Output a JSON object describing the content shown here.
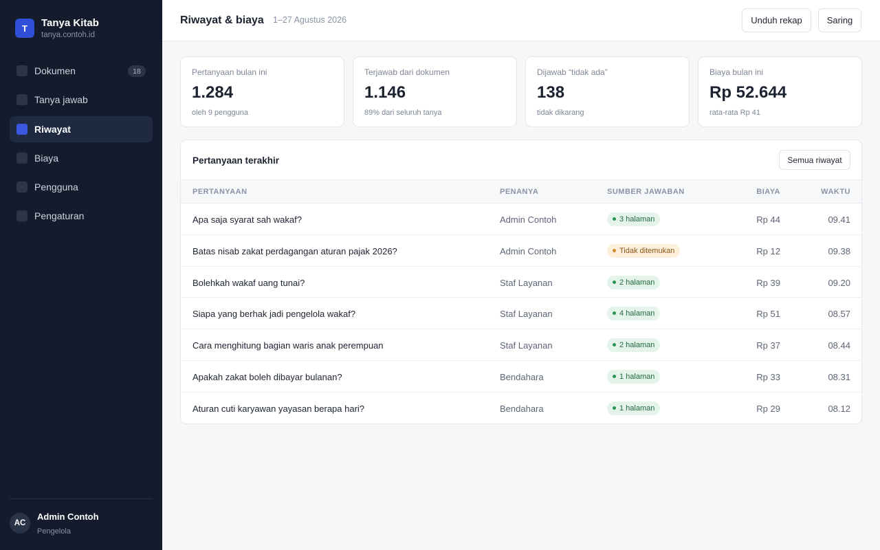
{
  "brand": {
    "logo_letter": "T",
    "name": "Tanya Kitab",
    "domain": "tanya.contoh.id"
  },
  "sidebar": {
    "items": [
      {
        "label": "Dokumen",
        "badge": "18",
        "active": false
      },
      {
        "label": "Tanya jawab",
        "active": false
      },
      {
        "label": "Riwayat",
        "active": true
      },
      {
        "label": "Biaya",
        "active": false
      },
      {
        "label": "Pengguna",
        "active": false
      },
      {
        "label": "Pengaturan",
        "active": false
      }
    ]
  },
  "user": {
    "initials": "AC",
    "name": "Admin Contoh",
    "role": "Pengelola"
  },
  "header": {
    "title": "Riwayat & biaya",
    "date_range": "1–27 Agustus 2026",
    "download_label": "Unduh rekap",
    "filter_label": "Saring"
  },
  "stats": [
    {
      "label": "Pertanyaan bulan ini",
      "value": "1.284",
      "sub": "oleh 9 pengguna"
    },
    {
      "label": "Terjawab dari dokumen",
      "value": "1.146",
      "sub": "89% dari seluruh tanya"
    },
    {
      "label": "Dijawab “tidak ada”",
      "value": "138",
      "sub": "tidak dikarang"
    },
    {
      "label": "Biaya bulan ini",
      "value": "Rp 52.644",
      "sub": "rata-rata Rp 41"
    }
  ],
  "recent": {
    "title": "Pertanyaan terakhir",
    "all_label": "Semua riwayat",
    "columns": [
      "PERTANYAAN",
      "PENANYA",
      "SUMBER JAWABAN",
      "BIAYA",
      "WAKTU"
    ],
    "rows": [
      {
        "question": "Apa saja syarat sah wakaf?",
        "asker": "Admin Contoh",
        "source": "3 halaman",
        "status": "ok",
        "cost": "Rp 44",
        "time": "09.41"
      },
      {
        "question": "Batas nisab zakat perdagangan aturan pajak 2026?",
        "asker": "Admin Contoh",
        "source": "Tidak ditemukan",
        "status": "warn",
        "cost": "Rp 12",
        "time": "09.38"
      },
      {
        "question": "Bolehkah wakaf uang tunai?",
        "asker": "Staf Layanan",
        "source": "2 halaman",
        "status": "ok",
        "cost": "Rp 39",
        "time": "09.20"
      },
      {
        "question": "Siapa yang berhak jadi pengelola wakaf?",
        "asker": "Staf Layanan",
        "source": "4 halaman",
        "status": "ok",
        "cost": "Rp 51",
        "time": "08.57"
      },
      {
        "question": "Cara menghitung bagian waris anak perempuan",
        "asker": "Staf Layanan",
        "source": "2 halaman",
        "status": "ok",
        "cost": "Rp 37",
        "time": "08.44"
      },
      {
        "question": "Apakah zakat boleh dibayar bulanan?",
        "asker": "Bendahara",
        "source": "1 halaman",
        "status": "ok",
        "cost": "Rp 33",
        "time": "08.31"
      },
      {
        "question": "Aturan cuti karyawan yayasan berapa hari?",
        "asker": "Bendahara",
        "source": "1 halaman",
        "status": "ok",
        "cost": "Rp 29",
        "time": "08.12"
      }
    ]
  }
}
